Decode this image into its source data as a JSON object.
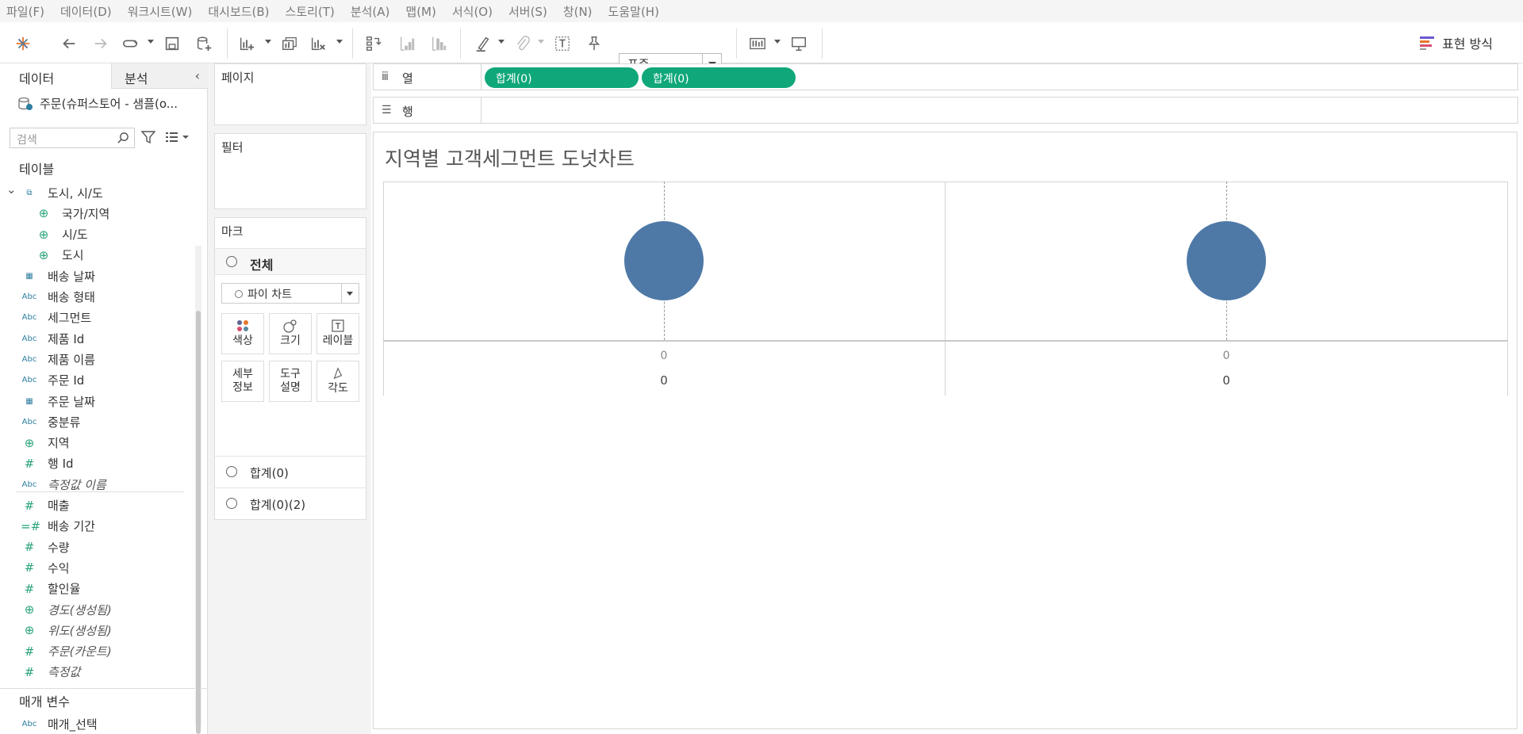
{
  "menu": [
    "파일(F)",
    "데이터(D)",
    "워크시트(W)",
    "대시보드(B)",
    "스토리(T)",
    "분석(A)",
    "맵(M)",
    "서식(O)",
    "서버(S)",
    "창(N)",
    "도움말(H)"
  ],
  "toolbar": {
    "fit_value": "표준",
    "show_me_label": "표현 방식"
  },
  "left_panel": {
    "tab_data": "데이터",
    "tab_analysis": "분석",
    "datasource": "주문(슈퍼스토어 - 샘플(o...",
    "search_placeholder": "검색",
    "tables_header": "테이블",
    "fields": [
      {
        "label": "도시, 시/도",
        "icon": "hierarchy-icon",
        "italic": false,
        "indent": 0
      },
      {
        "label": "국가/지역",
        "icon": "globe-icon",
        "italic": false,
        "indent": 1
      },
      {
        "label": "시/도",
        "icon": "globe-icon",
        "italic": false,
        "indent": 1
      },
      {
        "label": "도시",
        "icon": "globe-icon",
        "italic": false,
        "indent": 1
      },
      {
        "label": "배송 날짜",
        "icon": "calendar-icon",
        "italic": false,
        "indent": 0
      },
      {
        "label": "배송 형태",
        "icon": "Abc",
        "italic": false,
        "indent": 0
      },
      {
        "label": "세그먼트",
        "icon": "Abc",
        "italic": false,
        "indent": 0
      },
      {
        "label": "제품 Id",
        "icon": "Abc",
        "italic": false,
        "indent": 0
      },
      {
        "label": "제품 이름",
        "icon": "Abc",
        "italic": false,
        "indent": 0
      },
      {
        "label": "주문 Id",
        "icon": "Abc",
        "italic": false,
        "indent": 0
      },
      {
        "label": "주문 날짜",
        "icon": "calendar-icon",
        "italic": false,
        "indent": 0
      },
      {
        "label": "중분류",
        "icon": "Abc",
        "italic": false,
        "indent": 0
      },
      {
        "label": "지역",
        "icon": "globe-icon",
        "italic": false,
        "indent": 0
      },
      {
        "label": "행 Id",
        "icon": "#",
        "italic": false,
        "indent": 0
      },
      {
        "label": "측정값 이름",
        "icon": "Abc",
        "italic": true,
        "indent": 0
      },
      {
        "label": "매출",
        "icon": "#",
        "italic": false,
        "indent": 0
      },
      {
        "label": "배송 기간",
        "icon": "=#",
        "italic": false,
        "indent": 0
      },
      {
        "label": "수량",
        "icon": "#",
        "italic": false,
        "indent": 0
      },
      {
        "label": "수익",
        "icon": "#",
        "italic": false,
        "indent": 0
      },
      {
        "label": "할인율",
        "icon": "#",
        "italic": false,
        "indent": 0
      },
      {
        "label": "경도(생성됨)",
        "icon": "globe-icon",
        "italic": true,
        "indent": 0
      },
      {
        "label": "위도(생성됨)",
        "icon": "globe-icon",
        "italic": true,
        "indent": 0
      },
      {
        "label": "주문(카운트)",
        "icon": "#",
        "italic": true,
        "indent": 0
      },
      {
        "label": "측정값",
        "icon": "#",
        "italic": true,
        "indent": 0
      }
    ],
    "params_header": "매개 변수",
    "params": [
      {
        "label": "매개_선택",
        "icon": "Abc"
      }
    ]
  },
  "cards": {
    "pages": "페이지",
    "filters": "필터",
    "marks": "마크",
    "marks_all": "전체",
    "mark_type": "파이 차트",
    "buttons": {
      "color": "색상",
      "size": "크기",
      "label": "레이블",
      "detail": "세부\n정보",
      "tooltip": "도구\n설명",
      "angle": "각도"
    },
    "pill1": "합계(0)",
    "pill2": "합계(0)(2)"
  },
  "shelves": {
    "columns_label": "열",
    "rows_label": "행",
    "column_pills": [
      "합계(0)",
      "합계(0)"
    ]
  },
  "view": {
    "title": "지역별 고객세그먼트 도넛차트",
    "pie_color": "#4e79a7",
    "pill_color": "#10a77a"
  },
  "chart_data": {
    "type": "pie",
    "panes": [
      {
        "axis_label": "0",
        "header": "0",
        "value": 0
      },
      {
        "axis_label": "0",
        "header": "0",
        "value": 0
      }
    ]
  }
}
